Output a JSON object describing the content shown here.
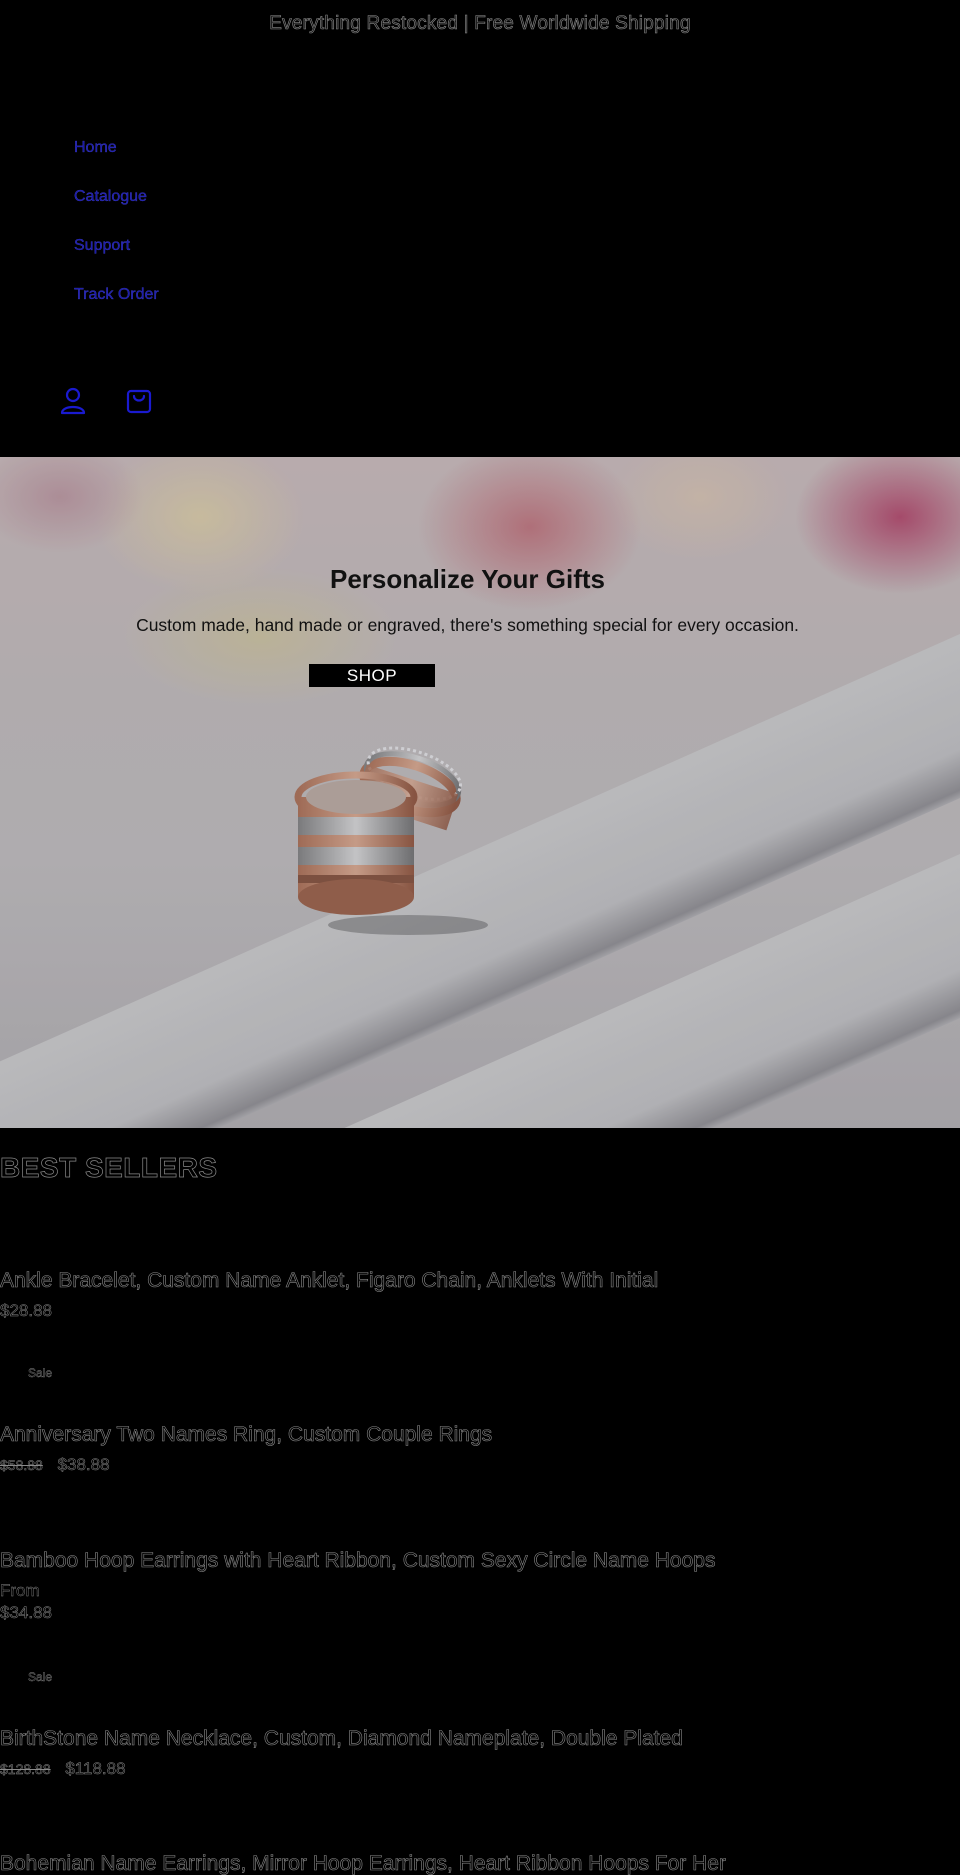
{
  "announcement": "Everything Restocked | Free Worldwide Shipping",
  "nav": {
    "items": [
      "Home",
      "Catalogue",
      "Support",
      "Track Order"
    ]
  },
  "header_icons": [
    "account-icon",
    "cart-icon"
  ],
  "accent_colors": {
    "nav_link": "#1a1aa8",
    "icon": "#1a1ad0",
    "background": "#000000"
  },
  "hero": {
    "title": "Personalize Your Gifts",
    "subtitle": "Custom made, hand made or engraved, there's something special for every occasion.",
    "button_label": "SHOP"
  },
  "best_sellers": {
    "title": "BEST SELLERS",
    "sale_label": "Sale",
    "products": [
      {
        "title": "Ankle Bracelet, Custom Name Anklet, Figaro Chain, Anklets With Initial",
        "price_prefix": "",
        "price_old": "",
        "price": "$28.88"
      },
      {
        "title": "Anniversary Two Names Ring, Custom Couple Rings",
        "price_prefix": "",
        "price_old": "$58.88",
        "price": "$38.88"
      },
      {
        "title": "Bamboo Hoop Earrings with Heart Ribbon, Custom Sexy Circle Name Hoops",
        "price_prefix": "From",
        "price_old": "",
        "price": "$34.88"
      },
      {
        "title": "BirthStone Name Necklace, Custom, Diamond Nameplate, Double Plated",
        "price_prefix": "",
        "price_old": "$128.88",
        "price": "$118.88"
      },
      {
        "title": "Bohemian Name Earrings, Mirror Hoop Earrings, Heart Ribbon Hoops For Her",
        "price_prefix": "",
        "price_old": "",
        "price": ""
      }
    ]
  }
}
